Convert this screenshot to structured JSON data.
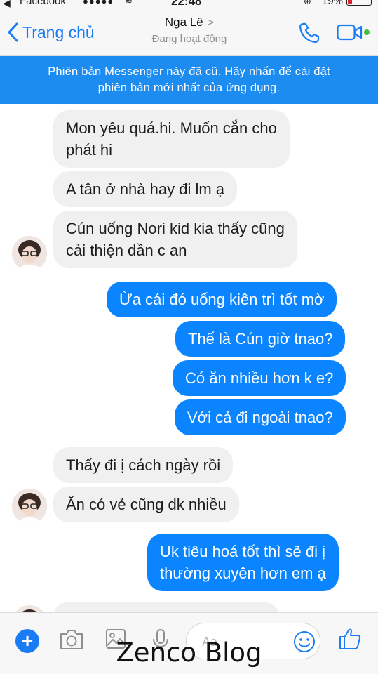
{
  "status_bar": {
    "app_name": "Facebook",
    "signal": "●●●●●",
    "clock": "22:48",
    "battery": "19%"
  },
  "header": {
    "back_label": "Trang chủ",
    "contact_name": "Nga Lê",
    "contact_status": "Đang hoạt động"
  },
  "banner": {
    "line1": "Phiên bản Messenger này đã cũ. Hãy nhấn để cài đặt",
    "line2": "phiên bản mới nhất của ứng dụng."
  },
  "messages": [
    {
      "from": "them",
      "lines": [
        "Mon yêu quá.hi. Muốn cắn cho",
        "phát hi"
      ]
    },
    {
      "from": "them",
      "lines": [
        "A tân ở nhà hay đi lm ạ"
      ]
    },
    {
      "from": "them",
      "lines": [
        "Cún uống Nori kid kia thấy cũng",
        "cải thiện dần c an"
      ]
    },
    {
      "from": "me",
      "lines": [
        "Ừa cái đó uống kiên trì tốt mờ"
      ]
    },
    {
      "from": "me",
      "lines": [
        "Thế là Cún giờ tnao?"
      ]
    },
    {
      "from": "me",
      "lines": [
        "Có ăn nhiều hơn k e?"
      ]
    },
    {
      "from": "me",
      "lines": [
        "Với cả đi ngoài tnao?"
      ]
    },
    {
      "from": "them",
      "lines": [
        "Thấy đi ị cách ngày rồi"
      ]
    },
    {
      "from": "them",
      "lines": [
        "Ăn có vẻ cũng dk nhiều"
      ]
    },
    {
      "from": "me",
      "lines": [
        "Uk tiêu hoá tốt thì sẽ đi ị",
        "thường xuyên hơn em ạ"
      ]
    }
  ],
  "composer": {
    "plus": "+",
    "placeholder": "Aa"
  },
  "watermark": "Zenco Blog",
  "colors": {
    "accent": "#1a7cf5",
    "banner": "#1c8cf0",
    "outgoing": "#0a84ff",
    "incoming": "#f0f0f0",
    "active": "#42c13a"
  },
  "icons": [
    "back-chevron-icon",
    "phone-icon",
    "video-camera-icon",
    "camera-icon",
    "image-icon",
    "microphone-icon",
    "emoji-icon",
    "thumbs-up-icon"
  ]
}
